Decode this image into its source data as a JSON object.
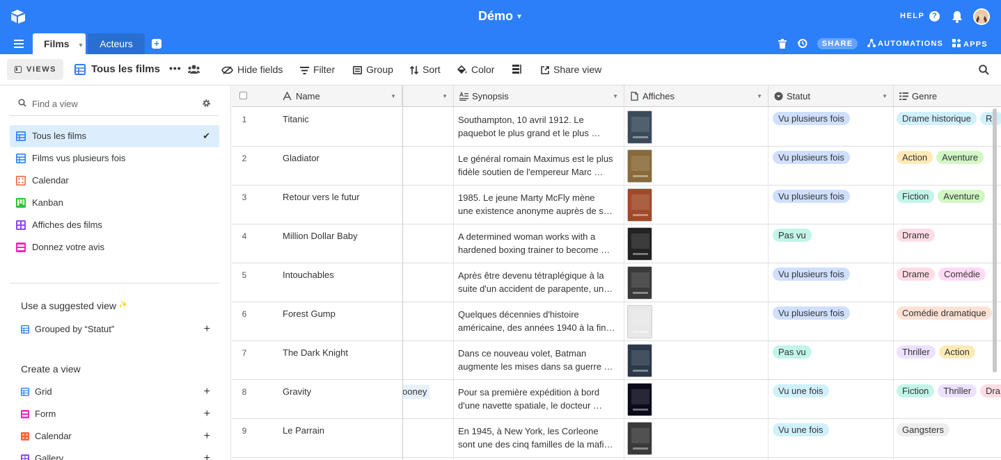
{
  "topbar": {
    "base_title": "Démo",
    "help_label": "HELP",
    "help_icon_glyph": "?"
  },
  "tabs": {
    "films_label": "Films",
    "acteurs_label": "Acteurs",
    "add_glyph": "+",
    "share_label": "SHARE",
    "automations_label": "AUTOMATIONS",
    "apps_label": "APPS"
  },
  "viewbar": {
    "views_label": "VIEWS",
    "current_view": "Tous les films",
    "more_glyph": "•••",
    "hide_fields": "Hide fields",
    "filter": "Filter",
    "group": "Group",
    "sort": "Sort",
    "color": "Color",
    "share_view": "Share view"
  },
  "sidebar": {
    "find_placeholder": "Find a view",
    "views": [
      {
        "label": "Tous les films",
        "icon": "grid-icon",
        "color": "#2d7ff9"
      },
      {
        "label": "Films vus plusieurs fois",
        "icon": "grid-icon",
        "color": "#2d7ff9"
      },
      {
        "label": "Calendar",
        "icon": "calendar-icon",
        "color": "#f7653b"
      },
      {
        "label": "Kanban",
        "icon": "kanban-icon",
        "color": "#20c933"
      },
      {
        "label": "Affiches des films",
        "icon": "gallery-icon",
        "color": "#8b46ff"
      },
      {
        "label": "Donnez votre avis",
        "icon": "form-icon",
        "color": "#e929ba"
      }
    ],
    "check_glyph": "✔",
    "suggested_title": "Use a suggested view",
    "suggested_sparkle": "✨",
    "suggested_item": "Grouped by “Statut”",
    "create_title": "Create a view",
    "create_items": [
      {
        "label": "Grid",
        "color": "#2d7ff9"
      },
      {
        "label": "Form",
        "color": "#e929ba"
      },
      {
        "label": "Calendar",
        "color": "#f7653b"
      },
      {
        "label": "Gallery",
        "color": "#8b46ff"
      }
    ],
    "plus_glyph": "+"
  },
  "grid": {
    "columns": {
      "name": "Name",
      "synopsis": "Synopsis",
      "affiches": "Affiches",
      "statut": "Statut",
      "genre": "Genre"
    },
    "rows": [
      {
        "num": "1",
        "name": "Titanic",
        "syn1": "Southampton, 10 avril 1912. Le",
        "syn2": "paquebot le plus grand et le plus …",
        "statut": "Vu plusieurs fois",
        "genres": [
          "Drame historique",
          "Ro"
        ],
        "poster": "#3a4a5a"
      },
      {
        "num": "2",
        "name": "Gladiator",
        "syn1": "Le général romain Maximus est le plus",
        "syn2": "fidèle soutien de l'empereur Marc …",
        "statut": "Vu plusieurs fois",
        "genres": [
          "Action",
          "Aventure"
        ],
        "poster": "#8a6a3a"
      },
      {
        "num": "3",
        "name": "Retour vers le futur",
        "syn1": " 1985. Le jeune Marty McFly mène",
        "syn2": "une existence anonyme auprès de s…",
        "statut": "Vu plusieurs fois",
        "genres": [
          "Fiction",
          "Aventure"
        ],
        "poster": "#a04a2a"
      },
      {
        "num": "4",
        "name": "Million Dollar Baby",
        "syn1": "A determined woman works with a",
        "syn2": "hardened boxing trainer to become …",
        "statut": "Pas vu",
        "genres": [
          "Drame"
        ],
        "poster": "#222222"
      },
      {
        "num": "5",
        "name": "Intouchables",
        "syn1": "Après être devenu tétraplégique à la",
        "syn2": "suite d'un accident de parapente, un…",
        "statut": "Vu plusieurs fois",
        "genres": [
          "Drame",
          "Comédie"
        ],
        "poster": "#3a3a3a"
      },
      {
        "num": "6",
        "name": "Forest Gump",
        "syn1": "Quelques décennies d'histoire",
        "syn2": "américaine, des années 1940 à la fin…",
        "statut": "Vu plusieurs fois",
        "genres": [
          "Comédie dramatique"
        ],
        "poster": "#e8e8e8"
      },
      {
        "num": "7",
        "name": "The Dark Knight",
        "syn1": "Dans ce nouveau volet, Batman",
        "syn2": "augmente les mises dans sa guerre …",
        "statut": "Pas vu",
        "genres": [
          "Thriller",
          "Action"
        ],
        "poster": "#2a3a4a"
      },
      {
        "num": "8",
        "name": "Gravity",
        "syn1": "Pour sa première expédition à bord",
        "syn2": "d'une navette spatiale, le docteur …",
        "statut": "Vu une fois",
        "genres": [
          "Fiction",
          "Thriller",
          "Dra"
        ],
        "poster": "#0a0a1a",
        "partial": "ooney"
      },
      {
        "num": "9",
        "name": "Le Parrain",
        "syn1": "En 1945, à New York, les Corleone",
        "syn2": "sont une des cinq familles de la mafi…",
        "statut": "Vu une fois",
        "genres": [
          "Gangsters"
        ],
        "poster": "#3a3a3a"
      }
    ]
  },
  "colors": {
    "topbar": "#2d7ff9",
    "statut": {
      "Vu plusieurs fois": "#cfdfff",
      "Pas vu": "#c2f5e9",
      "Vu une fois": "#d0f0fd"
    },
    "genre": {
      "Drame historique": "#d0f0fd",
      "Ro": "#d0f0fd",
      "Action": "#ffeab6",
      "Aventure": "#d1f7c4",
      "Fiction": "#c2f5e9",
      "Drame": "#ffdce5",
      "Comédie": "#ffdaf6",
      "Comédie dramatique": "#fee2d5",
      "Thriller": "#ede2fe",
      "Dra": "#ffdce5",
      "Gangsters": "#eeeeee"
    }
  }
}
